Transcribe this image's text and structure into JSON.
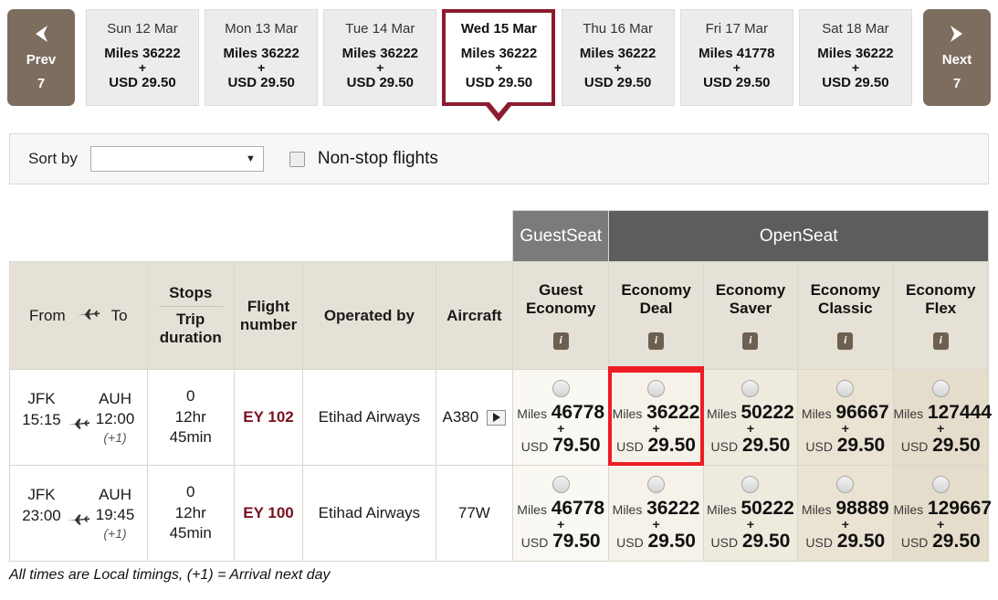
{
  "nav": {
    "prev": {
      "label": "Prev",
      "count": "7",
      "icon": "chevron-left-icon"
    },
    "next": {
      "label": "Next",
      "count": "7",
      "icon": "chevron-right-icon"
    }
  },
  "dates": [
    {
      "day": "Sun 12 Mar",
      "miles_label": "Miles",
      "miles": "36222",
      "plus": "+",
      "usd_label": "USD",
      "usd": "29.50",
      "selected": false
    },
    {
      "day": "Mon 13 Mar",
      "miles_label": "Miles",
      "miles": "36222",
      "plus": "+",
      "usd_label": "USD",
      "usd": "29.50",
      "selected": false
    },
    {
      "day": "Tue 14 Mar",
      "miles_label": "Miles",
      "miles": "36222",
      "plus": "+",
      "usd_label": "USD",
      "usd": "29.50",
      "selected": false
    },
    {
      "day": "Wed 15 Mar",
      "miles_label": "Miles",
      "miles": "36222",
      "plus": "+",
      "usd_label": "USD",
      "usd": "29.50",
      "selected": true
    },
    {
      "day": "Thu 16 Mar",
      "miles_label": "Miles",
      "miles": "36222",
      "plus": "+",
      "usd_label": "USD",
      "usd": "29.50",
      "selected": false
    },
    {
      "day": "Fri 17 Mar",
      "miles_label": "Miles",
      "miles": "41778",
      "plus": "+",
      "usd_label": "USD",
      "usd": "29.50",
      "selected": false
    },
    {
      "day": "Sat 18 Mar",
      "miles_label": "Miles",
      "miles": "36222",
      "plus": "+",
      "usd_label": "USD",
      "usd": "29.50",
      "selected": false
    }
  ],
  "sortbar": {
    "label": "Sort by",
    "select_value": "",
    "select_caret": "▼",
    "nonstop_label": "Non-stop flights",
    "nonstop_checked": false
  },
  "bands": {
    "guest": "GuestSeat",
    "open": "OpenSeat"
  },
  "columns": {
    "from": "From",
    "to": "To",
    "plane_icon": "airplane-icon",
    "stops": "Stops",
    "trip_duration": "Trip duration",
    "flight_number": "Flight number",
    "operated_by": "Operated by",
    "aircraft": "Aircraft"
  },
  "fare_columns": [
    {
      "name_line1": "Guest",
      "name_line2": "Economy",
      "info": "i",
      "key": "guest"
    },
    {
      "name_line1": "Economy",
      "name_line2": "Deal",
      "info": "i",
      "key": "deal"
    },
    {
      "name_line1": "Economy",
      "name_line2": "Saver",
      "info": "i",
      "key": "saver"
    },
    {
      "name_line1": "Economy",
      "name_line2": "Classic",
      "info": "i",
      "key": "classic"
    },
    {
      "name_line1": "Economy",
      "name_line2": "Flex",
      "info": "i",
      "key": "flex"
    }
  ],
  "rows": [
    {
      "from_code": "JFK",
      "from_time": "15:15",
      "to_code": "AUH",
      "to_time": "12:00",
      "to_next_day": "(+1)",
      "stops": "0",
      "duration_line1": "12hr",
      "duration_line2": "45min",
      "flight_number": "EY 102",
      "operated_by": "Etihad Airways",
      "aircraft": "A380",
      "has_video": true,
      "fares": [
        {
          "miles_label": "Miles",
          "miles": "46778",
          "plus": "+",
          "usd_label": "USD",
          "usd": "79.50",
          "selected": false
        },
        {
          "miles_label": "Miles",
          "miles": "36222",
          "plus": "+",
          "usd_label": "USD",
          "usd": "29.50",
          "selected": true
        },
        {
          "miles_label": "Miles",
          "miles": "50222",
          "plus": "+",
          "usd_label": "USD",
          "usd": "29.50",
          "selected": false
        },
        {
          "miles_label": "Miles",
          "miles": "96667",
          "plus": "+",
          "usd_label": "USD",
          "usd": "29.50",
          "selected": false
        },
        {
          "miles_label": "Miles",
          "miles": "127444",
          "plus": "+",
          "usd_label": "USD",
          "usd": "29.50",
          "selected": false
        }
      ]
    },
    {
      "from_code": "JFK",
      "from_time": "23:00",
      "to_code": "AUH",
      "to_time": "19:45",
      "to_next_day": "(+1)",
      "stops": "0",
      "duration_line1": "12hr",
      "duration_line2": "45min",
      "flight_number": "EY 100",
      "operated_by": "Etihad Airways",
      "aircraft": "77W",
      "has_video": false,
      "fares": [
        {
          "miles_label": "Miles",
          "miles": "46778",
          "plus": "+",
          "usd_label": "USD",
          "usd": "79.50",
          "selected": false
        },
        {
          "miles_label": "Miles",
          "miles": "36222",
          "plus": "+",
          "usd_label": "USD",
          "usd": "29.50",
          "selected": false
        },
        {
          "miles_label": "Miles",
          "miles": "50222",
          "plus": "+",
          "usd_label": "USD",
          "usd": "29.50",
          "selected": false
        },
        {
          "miles_label": "Miles",
          "miles": "98889",
          "plus": "+",
          "usd_label": "USD",
          "usd": "29.50",
          "selected": false
        },
        {
          "miles_label": "Miles",
          "miles": "129667",
          "plus": "+",
          "usd_label": "USD",
          "usd": "29.50",
          "selected": false
        }
      ]
    }
  ],
  "footnote": "All times are Local timings, (+1) = Arrival next day",
  "colors": {
    "selected_date_border": "#8c1b2f",
    "selection_highlight": "#ee1c25",
    "nav_button": "#7d6d5f",
    "flight_number": "#7a1120",
    "band_guest": "#7b7b7b",
    "band_open": "#5d5d5d"
  }
}
